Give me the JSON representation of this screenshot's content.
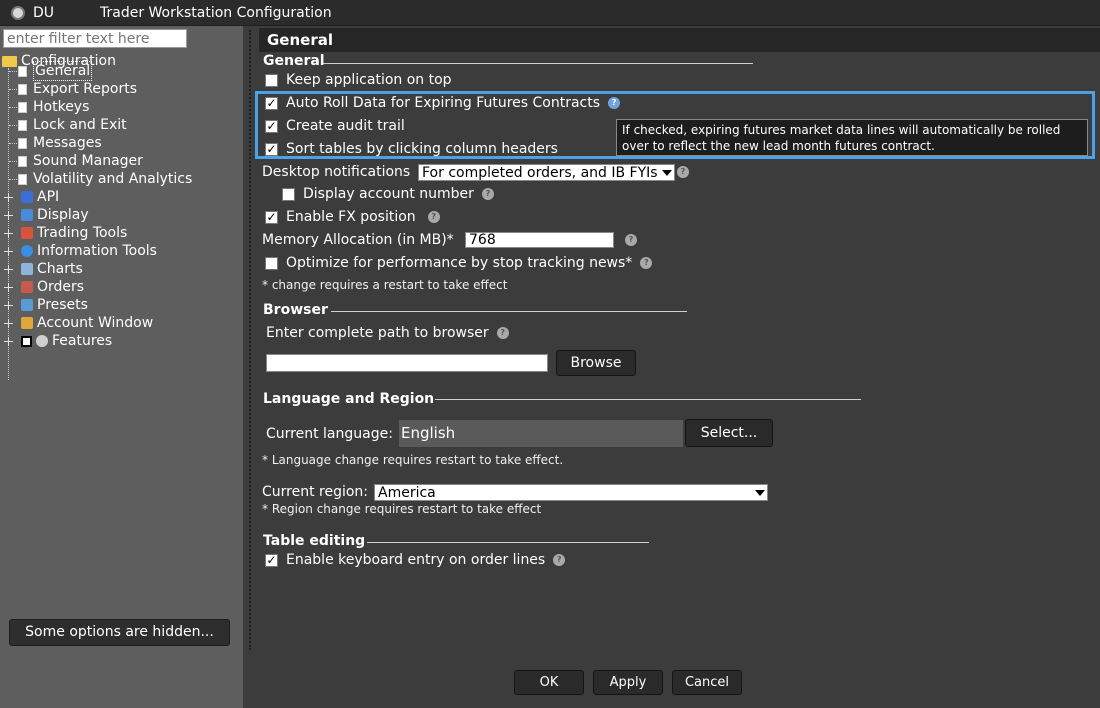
{
  "window": {
    "account": "DU",
    "title": "Trader Workstation Configuration"
  },
  "sidebar": {
    "filter_placeholder": "enter filter text here",
    "root_label": "Configuration",
    "items": [
      {
        "label": "General",
        "icon": "document-icon"
      },
      {
        "label": "Export Reports",
        "icon": "document-icon"
      },
      {
        "label": "Hotkeys",
        "icon": "document-icon"
      },
      {
        "label": "Lock and Exit",
        "icon": "document-icon"
      },
      {
        "label": "Messages",
        "icon": "document-icon"
      },
      {
        "label": "Sound Manager",
        "icon": "document-icon"
      },
      {
        "label": "Volatility and Analytics",
        "icon": "document-icon"
      }
    ],
    "groups": [
      {
        "label": "API",
        "icon": "api-icon",
        "color": "#3b6fd6"
      },
      {
        "label": "Display",
        "icon": "display-icon",
        "color": "#4a8ad8"
      },
      {
        "label": "Trading Tools",
        "icon": "trading-tools-icon",
        "color": "#d9533c"
      },
      {
        "label": "Information Tools",
        "icon": "info-icon",
        "color": "#3a8ee6"
      },
      {
        "label": "Charts",
        "icon": "chart-icon",
        "color": "#8fb3d9"
      },
      {
        "label": "Orders",
        "icon": "orders-icon",
        "color": "#c75a4a"
      },
      {
        "label": "Presets",
        "icon": "presets-icon",
        "color": "#5a9bd5"
      },
      {
        "label": "Account Window",
        "icon": "account-icon",
        "color": "#e0a83c"
      },
      {
        "label": "Features",
        "icon": "features-icon",
        "color": "#d0d0d0"
      }
    ],
    "hidden_button": "Some options are hidden..."
  },
  "panel": {
    "header": "General",
    "general": {
      "title": "General",
      "keep_on_top": {
        "label": "Keep application on top",
        "checked": false
      },
      "auto_roll": {
        "label": "Auto Roll Data for Expiring Futures Contracts",
        "checked": true
      },
      "audit_trail": {
        "label": "Create audit trail",
        "checked": true
      },
      "sort_tables": {
        "label": "Sort tables by clicking column headers",
        "checked": true
      },
      "tooltip": "If checked, expiring futures market data lines will automatically be rolled over to reflect the new lead month futures contract.",
      "desktop_notifications_label": "Desktop notifications",
      "desktop_notifications_value": "For completed orders, and IB FYIs",
      "display_account": {
        "label": "Display account number",
        "checked": false
      },
      "fx_position": {
        "label": "Enable FX position",
        "checked": true
      },
      "memory_label": "Memory Allocation (in MB)*",
      "memory_value": "768",
      "optimize": {
        "label": "Optimize for performance by stop tracking news*",
        "checked": false
      },
      "restart_note": "* change requires a restart to take effect"
    },
    "browser": {
      "title": "Browser",
      "path_label": "Enter complete path to browser",
      "path_value": "",
      "browse_button": "Browse"
    },
    "language": {
      "title": "Language and Region",
      "current_language_label": "Current language:",
      "current_language_value": "English",
      "select_button": "Select...",
      "language_note": "* Language change requires restart to take effect.",
      "current_region_label": "Current region:",
      "current_region_value": "America",
      "region_note": "* Region change requires restart to take effect"
    },
    "table_editing": {
      "title": "Table editing",
      "keyboard_entry": {
        "label": "Enable keyboard entry on order lines",
        "checked": true
      }
    }
  },
  "footer": {
    "ok": "OK",
    "apply": "Apply",
    "cancel": "Cancel"
  },
  "colors": {
    "highlight": "#4aa3e6",
    "background": "#3c3c3c",
    "sidebar": "#5e5e5e"
  }
}
